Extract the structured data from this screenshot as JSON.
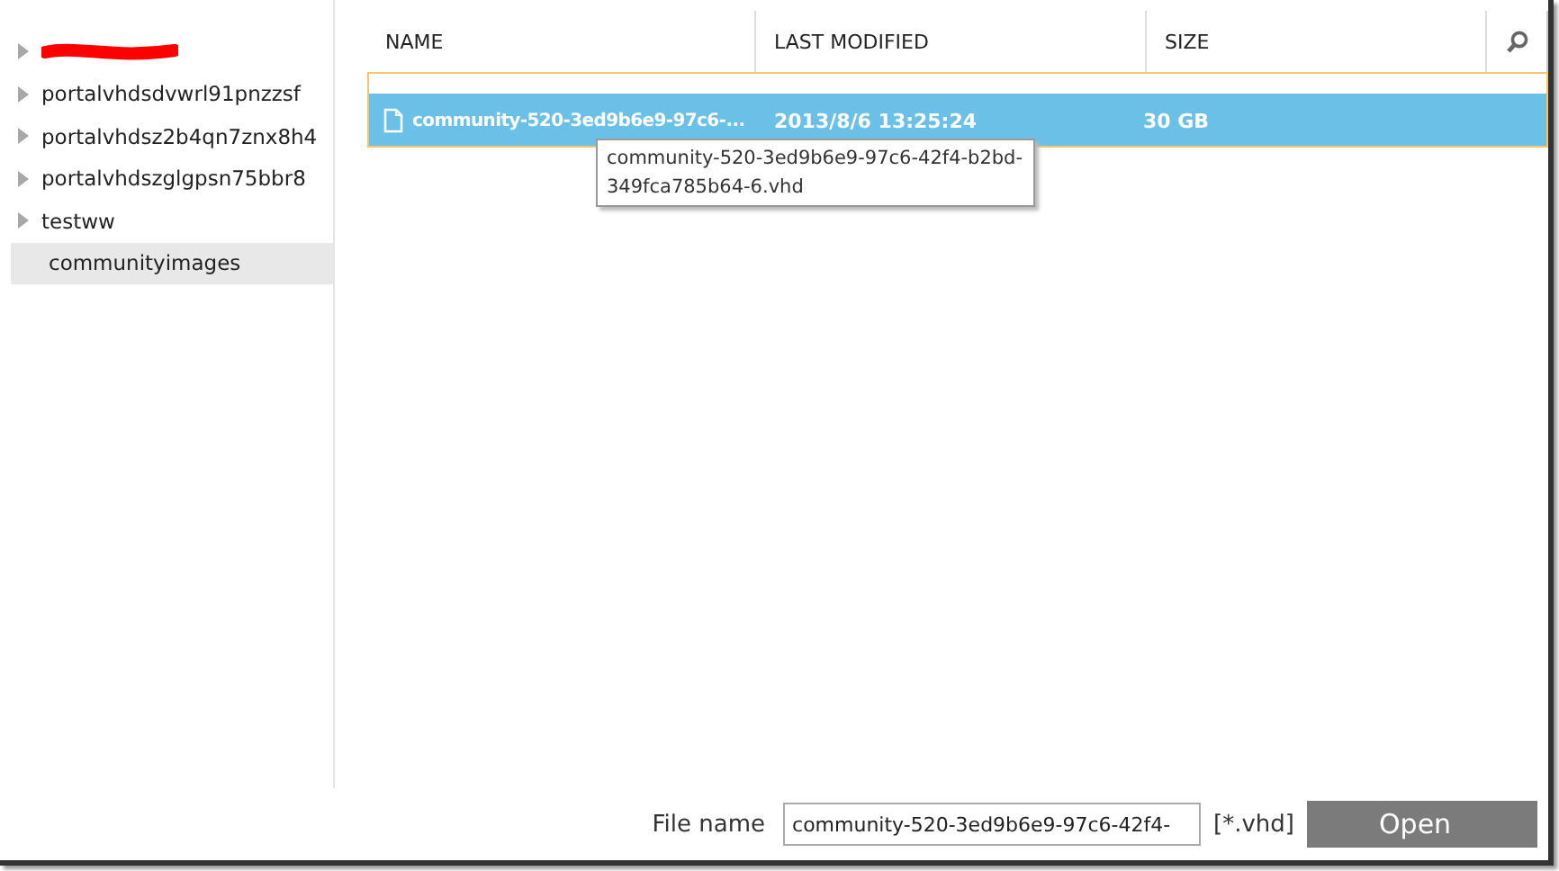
{
  "sidebar": {
    "items": [
      {
        "kind": "redacted",
        "expandable": true,
        "selected": false
      },
      {
        "label": "portalvhdsdvwrl91pnzzsf",
        "kind": "folder",
        "expandable": true,
        "selected": false
      },
      {
        "label": "portalvhdsz2b4qn7znx8h4",
        "kind": "folder",
        "expandable": true,
        "selected": false
      },
      {
        "label": "portalvhdszglgpsn75bbr8",
        "kind": "folder",
        "expandable": true,
        "selected": false
      },
      {
        "label": "testww",
        "kind": "folder",
        "expandable": true,
        "selected": false
      },
      {
        "label": "communityimages",
        "kind": "folder",
        "expandable": false,
        "selected": true
      }
    ]
  },
  "table": {
    "columns": [
      "NAME",
      "LAST MODIFIED",
      "SIZE"
    ],
    "rows": [
      {
        "name": "community-520-3ed9b6e9-97c6-...",
        "modified": "2013/8/6 13:25:24",
        "size": "30 GB",
        "selected": true
      }
    ]
  },
  "tooltip": "community-520-3ed9b6e9-97c6-42f4-b2bd-349fca785b64-6.vhd",
  "footer": {
    "label": "File name",
    "value": "community-520-3ed9b6e9-97c6-42f4-",
    "filter": "[*.vhd]",
    "button": "Open"
  }
}
